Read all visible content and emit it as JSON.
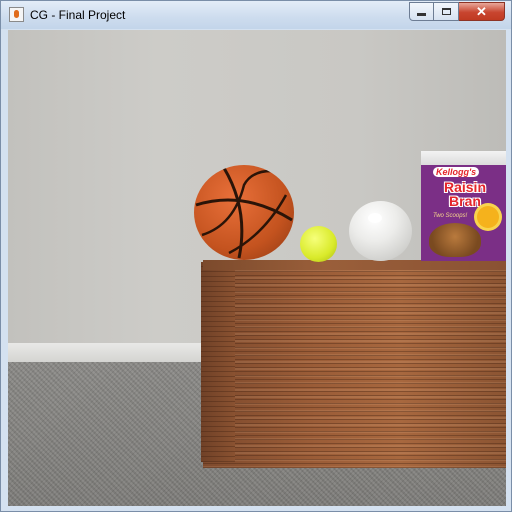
{
  "window": {
    "title": "CG - Final Project",
    "icon": "java-app-icon"
  },
  "window_controls": {
    "minimize": "minimize-icon",
    "maximize": "maximize-icon",
    "close": "close-icon",
    "close_glyph": "✕"
  },
  "scene": {
    "objects": [
      "basketball",
      "tennis-ball",
      "white-ball",
      "cereal-box",
      "wooden-table"
    ],
    "cereal_box": {
      "brand": "Kellogg's",
      "name_line1": "Raisin",
      "name_line2": "Bran",
      "tagline": "Two Scoops!"
    }
  }
}
